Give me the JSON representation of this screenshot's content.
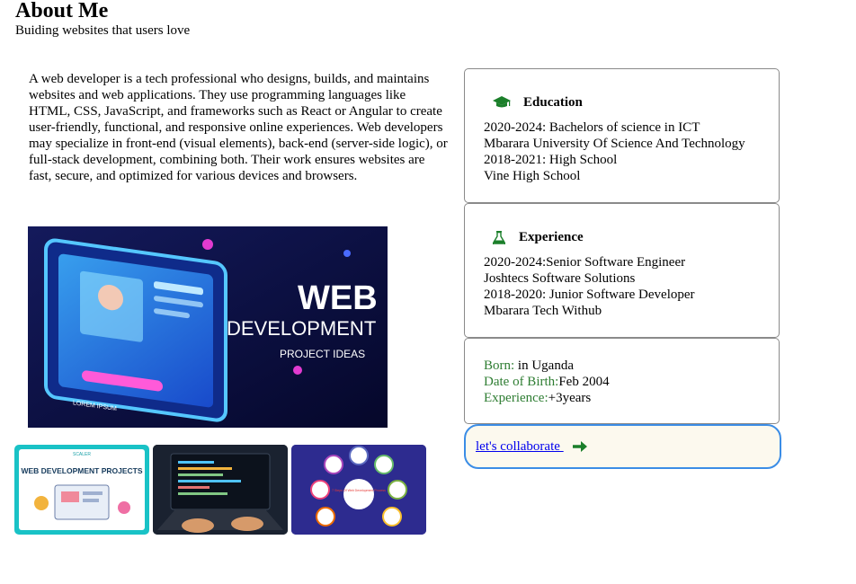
{
  "header": {
    "title": "About Me",
    "subtitle": "Buiding websites that users love"
  },
  "about": {
    "paragraph": "A web developer is a tech professional who designs, builds, and maintains websites and web applications. They use programming languages like HTML, CSS, JavaScript, and frameworks such as React or Angular to create user-friendly, functional, and responsive online experiences. Web developers may specialize in front-end (visual elements), back-end (server-side logic), or full-stack development, combining both. Their work ensures websites are fast, secure, and optimized for various devices and browsers."
  },
  "hero": {
    "line1": "WEB",
    "line2": "DEVELOPMENT",
    "line3": "PROJECT IDEAS",
    "screen_text": "LOREM IPSUM"
  },
  "thumbnails": [
    {
      "title": "WEB DEVELOPMENT PROJECTS",
      "brand": "SCALER"
    },
    {
      "title": ""
    },
    {
      "title": "7 Steps Of Web Development Process"
    }
  ],
  "education": {
    "heading": "Education",
    "icon": "graduation-cap-icon",
    "lines": [
      "2020-2024: Bachelors of science in ICT",
      "Mbarara University Of Science And Technology",
      "2018-2021: High School",
      "Vine High School"
    ]
  },
  "experience": {
    "heading": "Experience",
    "icon": "flask-icon",
    "lines": [
      "2020-2024:Senior Software Engineer",
      "Joshtecs Software Solutions",
      "2018-2020: Junior Software Developer",
      "Mbarara Tech Withub"
    ]
  },
  "info": {
    "born_label": "Born:",
    "born_value": " in Uganda",
    "dob_label": "Date of Birth:",
    "dob_value": "Feb 2004",
    "exp_label": "Experience:",
    "exp_value": "+3years"
  },
  "collaborate": {
    "label": "let's collaborate ",
    "icon": "arrow-right-icon"
  },
  "colors": {
    "accent_green": "#1b7f2a",
    "label_green": "#2e7d32",
    "button_border": "#3b8de6",
    "button_bg": "#fcf9ee",
    "link": "#0000ee"
  }
}
